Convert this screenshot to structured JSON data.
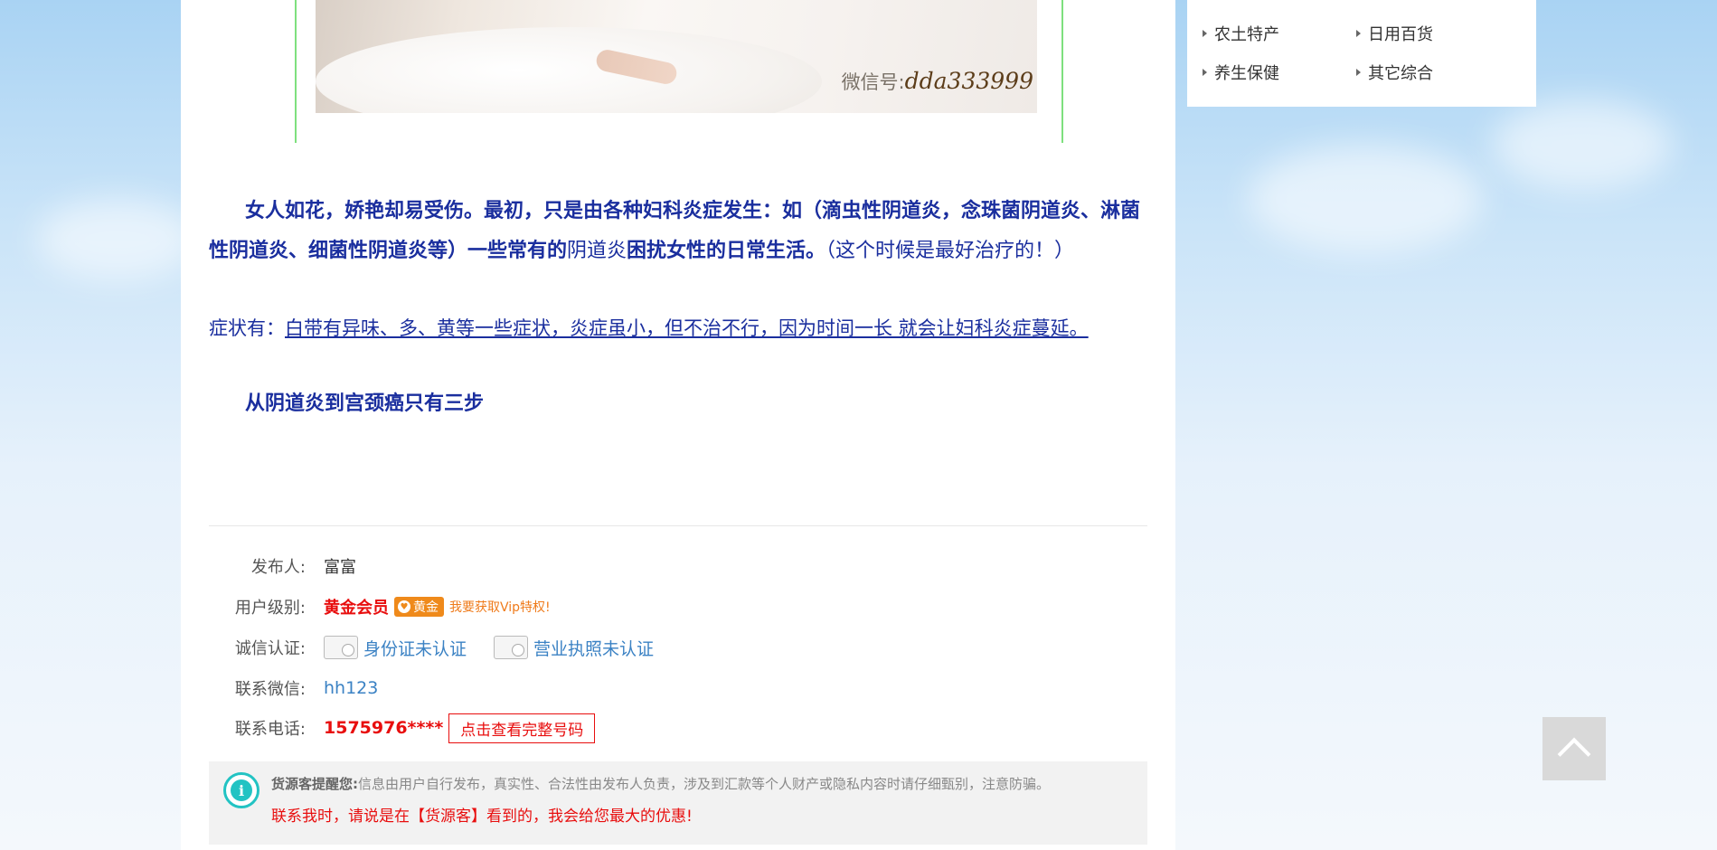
{
  "article": {
    "photo_watermark_prefix": "微信号:",
    "photo_watermark_id": "dda333999",
    "p1_bold_a": "女人如花，娇艳却易受伤。最初，只是由各种妇科炎症发生：如（滴虫性阴道炎，念珠菌阴道炎、淋菌性阴道炎、细菌性阴道炎等）一些常有的",
    "p1_serif_a": "阴道炎",
    "p1_bold_b": "困扰女性的日常生活。",
    "p1_serif_b": "（这个时候是最好治疗的！）",
    "p2_prefix": "症状有：",
    "p2_underlined": "白带有异味、多、黄等一些症状，炎症虽小，但不治不行，因为时间一长 就会让妇科炎症蔓延。",
    "p3": "从阴道炎到宫颈癌只有三步"
  },
  "info": {
    "publisher_label": "发布人:",
    "publisher_value": "富富",
    "level_label": "用户级别:",
    "level_value": "黄金会员",
    "level_badge": "黄金",
    "vip_link": "我要获取Vip特权!",
    "cert_label": "诚信认证:",
    "cert_id": "身份证未认证",
    "cert_business": "营业执照未认证",
    "wechat_label": "联系微信:",
    "wechat_value": "hh123",
    "phone_label": "联系电话:",
    "phone_value": "1575976****",
    "phone_button": "点击查看完整号码"
  },
  "notice": {
    "title": "货源客提醒您:",
    "text": "信息由用户自行发布，真实性、合法性由发布人负责，涉及到汇款等个人财产或隐私内容时请仔细甄别，注意防骗。",
    "promo": "联系我时，请说是在【货源客】看到的，我会给您最大的优惠!"
  },
  "sidebar": {
    "categories": [
      "农土特产",
      "日用百货",
      "养生保健",
      "其它综合"
    ]
  },
  "icons": {
    "back_to_top": "chevron-up-icon",
    "notice": "info-icon",
    "cert": "id-card-icon"
  },
  "colors": {
    "article_text": "#1a2e9e",
    "alert_red": "#e80e0e",
    "link_blue": "#3b82c4",
    "badge_orange": "#ef8a1b",
    "notice_teal": "#22c3c3"
  }
}
